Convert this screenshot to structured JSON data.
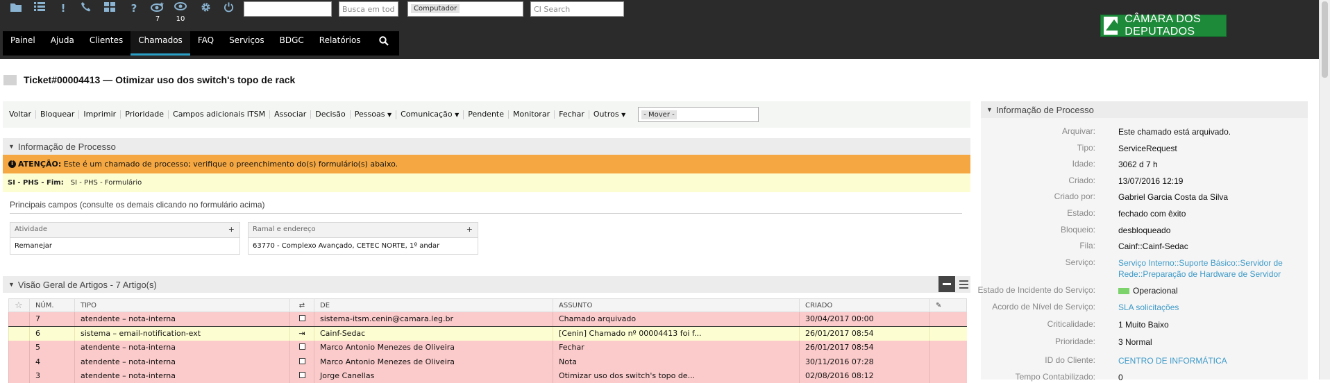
{
  "toolbar": {
    "icons": [
      "folder-icon",
      "list-icon",
      "exclamation-icon",
      "phone-icon",
      "dashboard-icon",
      "help-icon",
      "eye-new-icon",
      "eye-icon",
      "gear-icon",
      "power-icon"
    ],
    "eye_new_count": "7",
    "eye_count": "10",
    "search_all_placeholder": "Busca em tod",
    "computer_selected": "Computador",
    "ci_search_placeholder": "CI Search"
  },
  "nav": {
    "items": [
      "Painel",
      "Ajuda",
      "Clientes",
      "Chamados",
      "FAQ",
      "Serviços",
      "BDGC",
      "Relatórios"
    ],
    "active": "Chamados"
  },
  "logo": {
    "text": "CÂMARA DOS DEPUTADOS"
  },
  "ticket": {
    "title": "Ticket#00004413 — Otimizar uso dos switch's topo de rack"
  },
  "actions": {
    "items": [
      "Voltar",
      "Bloquear",
      "Imprimir",
      "Prioridade",
      "Campos adicionais ITSM",
      "Associar",
      "Decisão",
      "Pessoas",
      "Comunicação",
      "Pendente",
      "Monitorar",
      "Fechar",
      "Outros"
    ],
    "move_selected": "- Mover -"
  },
  "process": {
    "header": "Informação de Processo",
    "attention_label": "ATENÇÃO:",
    "attention_text": "Este é um chamado de processo; verifique o preenchimento do(s) formulário(s) abaixo.",
    "flow_label": "SI - PHS - Fim:",
    "flow_value": "SI - PHS - Formulário",
    "main_fields_text": "Principais campos (consulte os demais clicando no formulário acima)",
    "fields": [
      {
        "label": "Atividade",
        "value": "Remanejar"
      },
      {
        "label": "Ramal e endereço",
        "value": "63770 - Complexo Avançado, CETEC NORTE, 1º andar"
      }
    ]
  },
  "articles": {
    "header": "Visão Geral de Artigos - 7 Artigo(s)",
    "columns": [
      "NÚM.",
      "TIPO",
      "DE",
      "ASSUNTO",
      "CRIADO"
    ],
    "rows": [
      {
        "num": "7",
        "tipo": "atendente – nota-interna",
        "de": "sistema-itsm.cenin@camara.leg.br",
        "assunto": "Chamado arquivado",
        "criado": "30/04/2017 00:00"
      },
      {
        "num": "6",
        "tipo": "sistema – email-notification-ext",
        "de": "Cainf-Sedac",
        "assunto": "[Cenin] Chamado nº 00004413 foi f...",
        "criado": "26/01/2017 08:54"
      },
      {
        "num": "5",
        "tipo": "atendente – nota-interna",
        "de": "Marco Antonio Menezes de Oliveira",
        "assunto": "Fechar",
        "criado": "26/01/2017 08:54"
      },
      {
        "num": "4",
        "tipo": "atendente – nota-interna",
        "de": "Marco Antonio Menezes de Oliveira",
        "assunto": "Nota",
        "criado": "30/11/2016 07:28"
      },
      {
        "num": "3",
        "tipo": "atendente – nota-interna",
        "de": "Jorge Canellas",
        "assunto": "Otimizar uso dos switch's topo de...",
        "criado": "02/08/2016 08:12"
      }
    ]
  },
  "sidebar": {
    "header": "Informação de Processo",
    "rows": [
      {
        "k": "Arquivar:",
        "v": "Este chamado está arquivado."
      },
      {
        "k": "Tipo:",
        "v": "ServiceRequest"
      },
      {
        "k": "Idade:",
        "v": "3062 d 7 h"
      },
      {
        "k": "Criado:",
        "v": "13/07/2016 12:19"
      },
      {
        "k": "Criado por:",
        "v": "Gabriel Garcia Costa da Silva"
      },
      {
        "k": "Estado:",
        "v": "fechado com êxito"
      },
      {
        "k": "Bloqueio:",
        "v": "desbloqueado"
      },
      {
        "k": "Fila:",
        "v": "Cainf::Cainf-Sedac"
      },
      {
        "k": "Serviço:",
        "v": "Serviço Interno::Suporte Básico::Servidor de Rede::Preparação de Hardware de Servidor"
      },
      {
        "k": "Estado de Incidente do Serviço:",
        "v": "Operacional"
      },
      {
        "k": "Acordo de Nível de Serviço:",
        "v": "SLA solicitações"
      },
      {
        "k": "Criticalidade:",
        "v": "1 Muito Baixo"
      },
      {
        "k": "Prioridade:",
        "v": "3 Normal"
      },
      {
        "k": "ID do Cliente:",
        "v": "CENTRO DE INFORMÁTICA"
      },
      {
        "k": "Tempo Contabilizado:",
        "v": "0"
      }
    ],
    "status_color": "#7dd36b",
    "link_color": "#3d9ac8"
  }
}
